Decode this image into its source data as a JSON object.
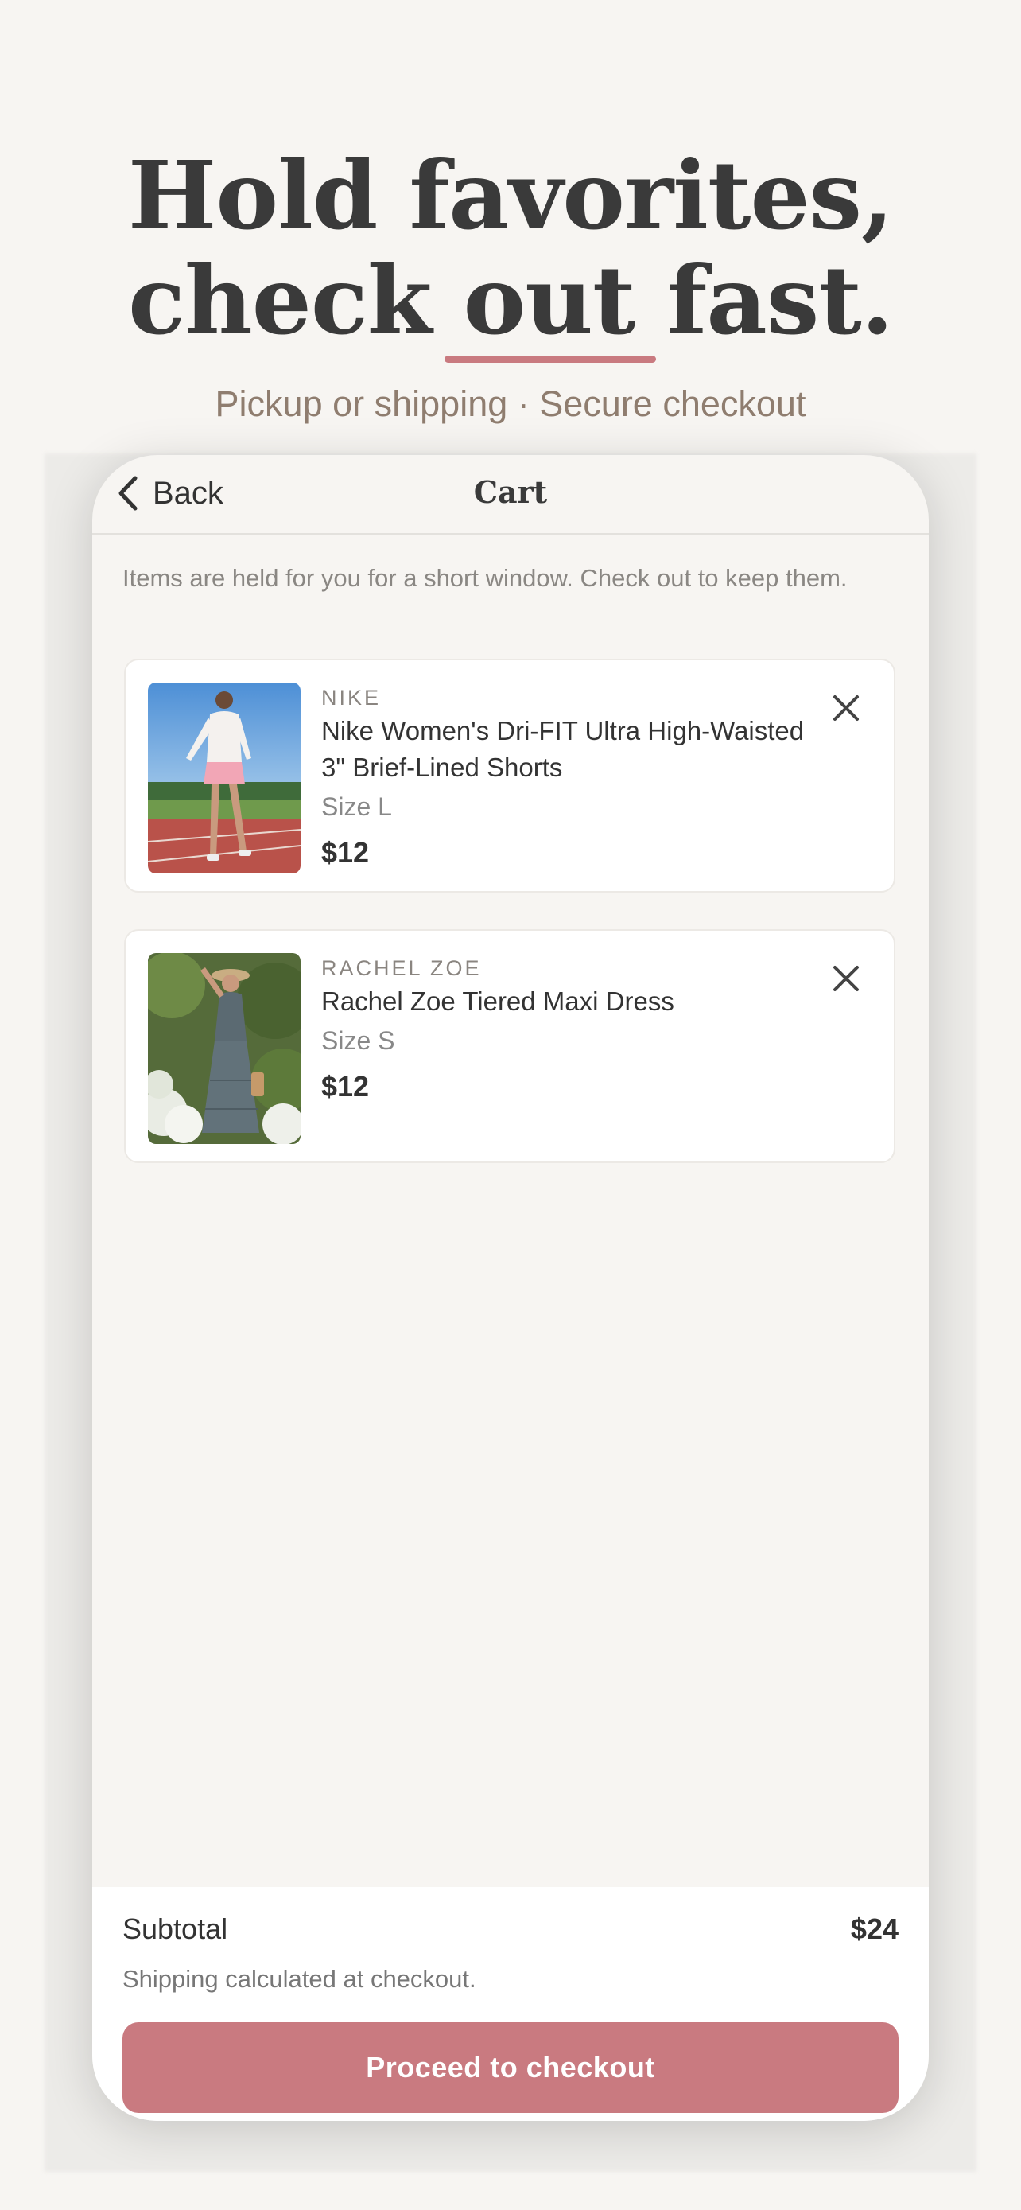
{
  "headline": {
    "line1": "Hold favorites,",
    "line2_pre": "check ",
    "line2_emph": "out",
    "line2_post": " fast."
  },
  "subtitle": "Pickup or shipping · Secure checkout",
  "header": {
    "back_label": "Back",
    "title": "Cart"
  },
  "notice": "Items are held for you for a short window. Check out to keep them.",
  "items": [
    {
      "brand": "NIKE",
      "name": "Nike Women's Dri-FIT Ultra High-Waisted 3\" Brief-Lined Shorts",
      "size": "Size L",
      "price": "$12"
    },
    {
      "brand": "RACHEL ZOE",
      "name": "Rachel Zoe Tiered Maxi Dress",
      "size": "Size S",
      "price": "$12"
    }
  ],
  "footer": {
    "subtotal_label": "Subtotal",
    "subtotal_value": "$24",
    "shipping_note": "Shipping calculated at checkout.",
    "checkout_label": "Proceed to checkout"
  },
  "colors": {
    "accent": "#c97a80",
    "background": "#f7f5f2",
    "text": "#333333"
  }
}
